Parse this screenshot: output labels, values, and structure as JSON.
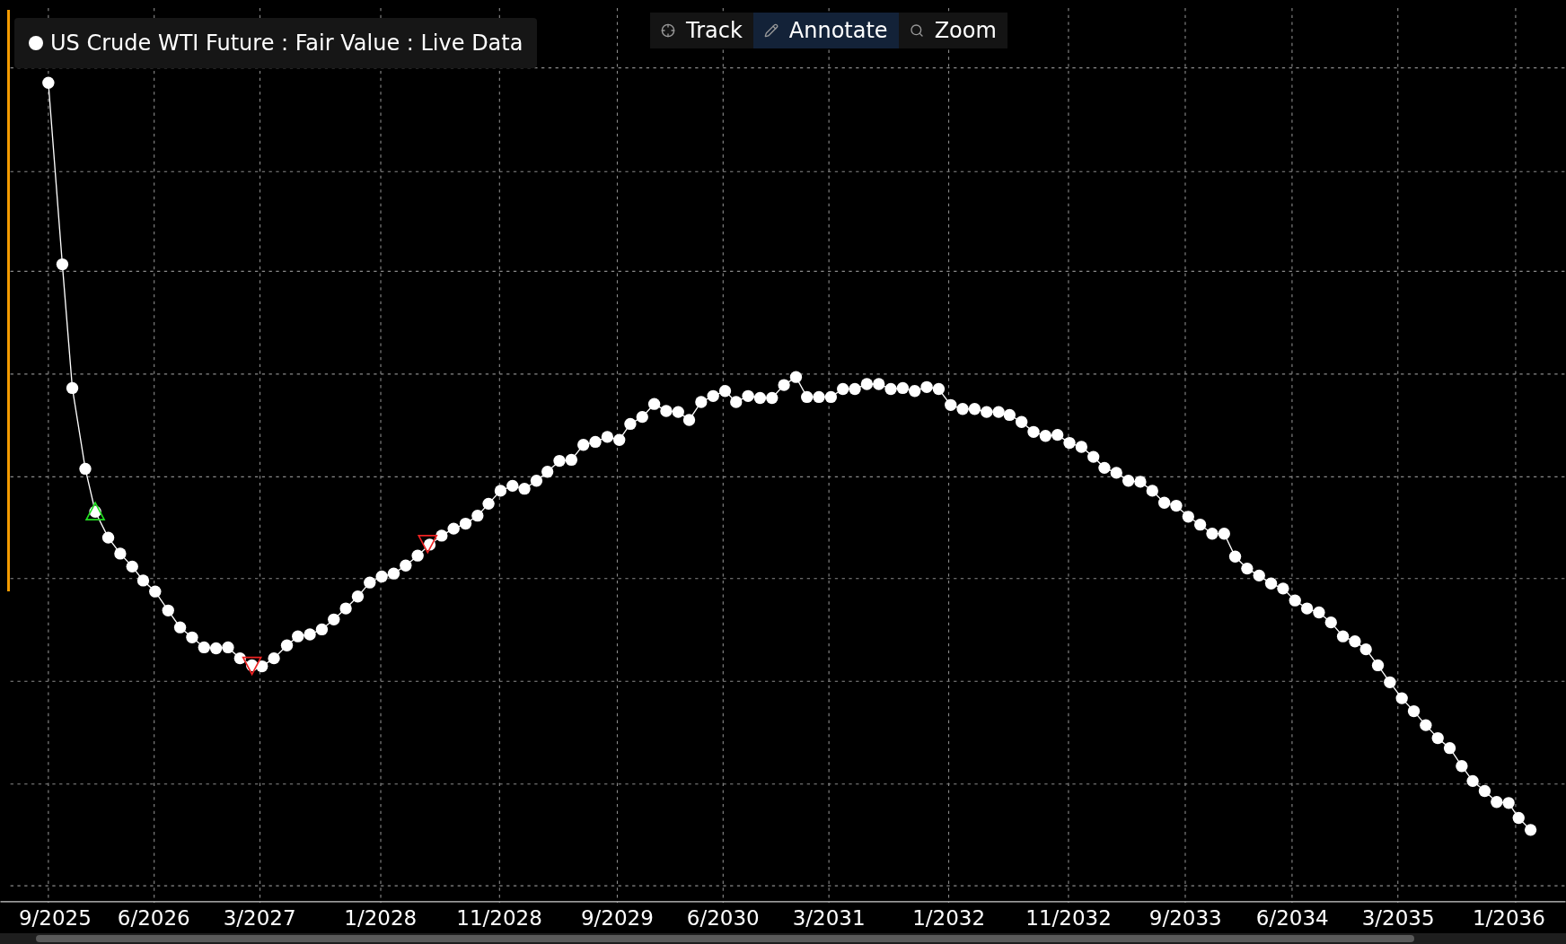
{
  "legend": {
    "text": "US Crude WTI Future : Fair Value : Live Data"
  },
  "tools": [
    {
      "label": "Track",
      "kind": "crosshair",
      "selected": false
    },
    {
      "label": "Annotate",
      "kind": "pencil",
      "selected": true
    },
    {
      "label": "Zoom",
      "kind": "search",
      "selected": false
    }
  ],
  "x_axis": {
    "labels": [
      "9/2025",
      "6/2026",
      "3/2027",
      "1/2028",
      "11/2028",
      "9/2029",
      "6/2030",
      "3/2031",
      "1/2032",
      "11/2032",
      "9/2033",
      "6/2034",
      "3/2035",
      "1/2036"
    ]
  }
}
